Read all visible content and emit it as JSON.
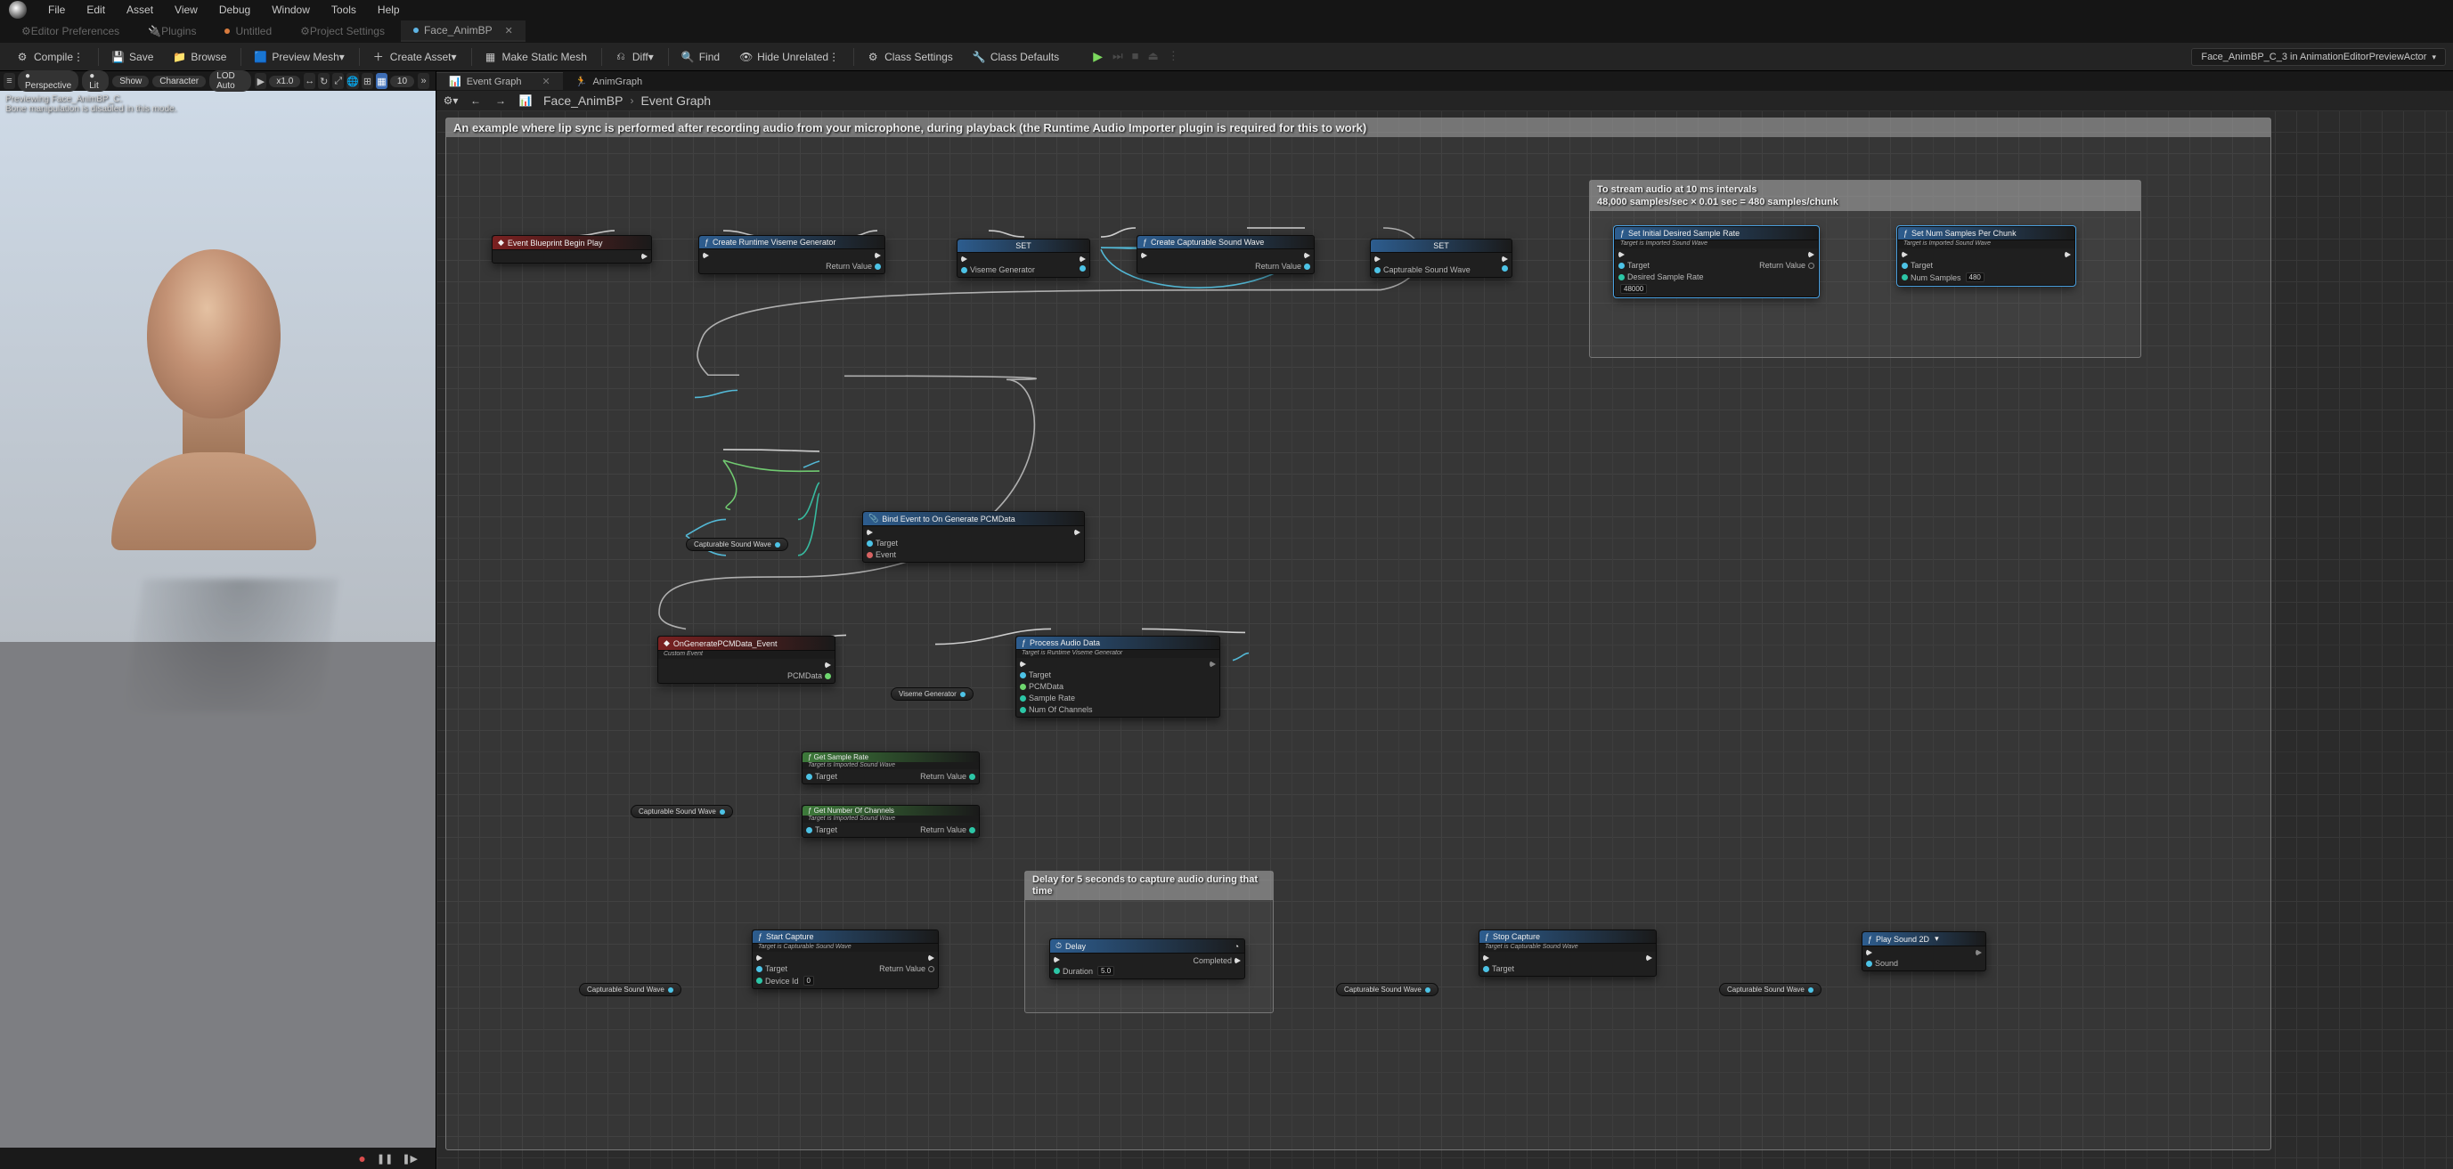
{
  "menu": {
    "items": [
      "File",
      "Edit",
      "Asset",
      "View",
      "Debug",
      "Window",
      "Tools",
      "Help"
    ]
  },
  "subtabs": {
    "editor_prefs": "Editor Preferences",
    "plugins": "Plugins",
    "untitled": "Untitled",
    "project_settings": "Project Settings",
    "active": "Face_AnimBP"
  },
  "toolbar": {
    "compile": "Compile",
    "save": "Save",
    "browse": "Browse",
    "preview_mesh": "Preview Mesh",
    "create_asset": "Create Asset",
    "make_static": "Make Static Mesh",
    "diff": "Diff",
    "find": "Find",
    "hide_unrelated": "Hide Unrelated",
    "class_settings": "Class Settings",
    "class_defaults": "Class Defaults",
    "dropdown": "Face_AnimBP_C_3 in AnimationEditorPreviewActor"
  },
  "viewport": {
    "perspective": "Perspective",
    "lit": "Lit",
    "show": "Show",
    "character": "Character",
    "lod": "LOD Auto",
    "speed": "x1.0",
    "grid": "10",
    "status1": "Previewing Face_AnimBP_C.",
    "status2": "Bone manipulation is disabled in this mode."
  },
  "graph_tabs": {
    "event": "Event Graph",
    "anim": "AnimGraph"
  },
  "breadcrumb": {
    "root": "Face_AnimBP",
    "leaf": "Event Graph"
  },
  "comments": {
    "main": "An example where lip sync is performed after recording audio from your microphone, during playback (the Runtime Audio Importer plugin is required for this to work)",
    "stream": "To stream audio at 10 ms intervals\n48,000 samples/sec × 0.01 sec = 480 samples/chunk",
    "delay": "Delay for 5 seconds to capture audio during that time"
  },
  "nodes": {
    "begin_play": "Event Blueprint Begin Play",
    "create_viseme": "Create Runtime Viseme Generator",
    "create_viseme_ret": "Return Value",
    "set1": "SET",
    "viseme_var": "Viseme Generator",
    "create_wave": "Create Capturable Sound Wave",
    "create_wave_ret": "Return Value",
    "set2": "SET",
    "wave_var": "Capturable Sound Wave",
    "set_rate": "Set Initial Desired Sample Rate",
    "set_rate_sub": "Target is Imported Sound Wave",
    "target": "Target",
    "return_value": "Return Value",
    "desired_rate": "Desired Sample Rate",
    "desired_rate_val": "48000",
    "set_num": "Set Num Samples Per Chunk",
    "set_num_sub": "Target is Imported Sound Wave",
    "num_samples": "Num Samples",
    "num_samples_val": "480",
    "on_pcm_evt": "OnGeneratePCMData_Event",
    "custom_event": "Custom Event",
    "pcmdata": "PCMData",
    "bind_evt": "Bind Event to On Generate PCMData",
    "event": "Event",
    "process_audio": "Process Audio Data",
    "process_sub": "Target is Runtime Viseme Generator",
    "sample_rate": "Sample Rate",
    "num_channels": "Num Of Channels",
    "get_rate": "Get Sample Rate",
    "get_rate_sub": "Target is Imported Sound Wave",
    "get_ch": "Get Number Of Channels",
    "get_ch_sub": "Target is Imported Sound Wave",
    "start_cap": "Start Capture",
    "start_sub": "Target is Capturable Sound Wave",
    "device_id": "Device Id",
    "device_id_val": "0",
    "delay": "Delay",
    "completed": "Completed",
    "duration": "Duration",
    "duration_val": "5.0",
    "stop_cap": "Stop Capture",
    "stop_sub": "Target is Capturable Sound Wave",
    "play2d": "Play Sound 2D",
    "sound": "Sound",
    "var_wave": "Capturable Sound Wave",
    "var_viseme": "Viseme Generator"
  }
}
